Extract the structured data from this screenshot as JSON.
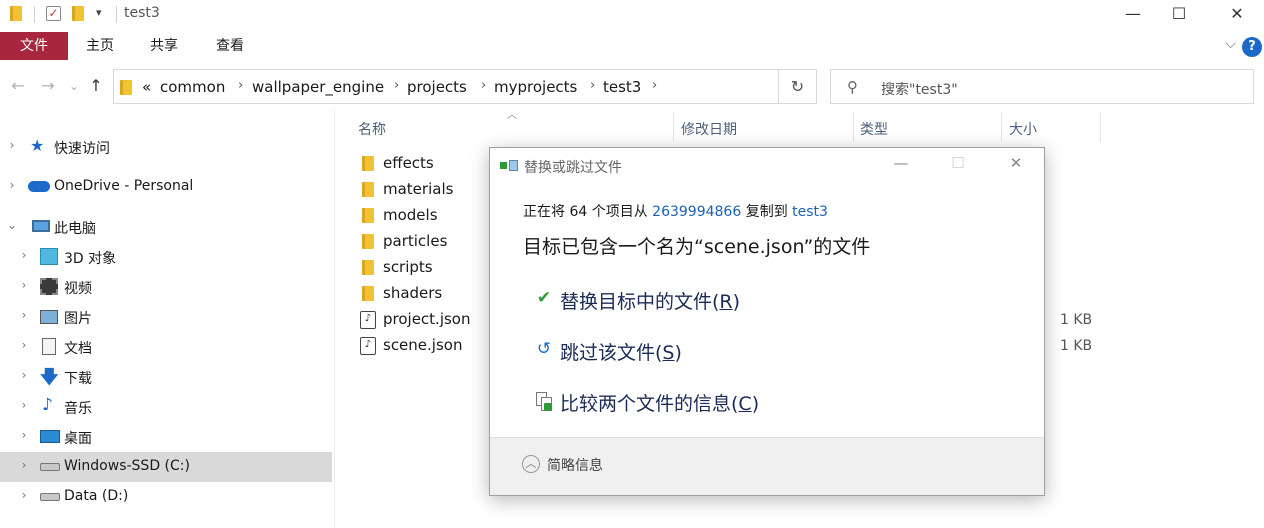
{
  "window": {
    "title": "test3",
    "minimize": "—",
    "maximize": "☐",
    "close": "✕"
  },
  "ribbon": {
    "tabs": [
      "文件",
      "主页",
      "共享",
      "查看"
    ],
    "help": "?",
    "expand": "⌵"
  },
  "nav": {
    "back": "←",
    "forward": "→",
    "recent": "⌄",
    "up": "↑",
    "breadcrumb_overflow": "«",
    "breadcrumbs": [
      "common",
      "wallpaper_engine",
      "projects",
      "myprojects",
      "test3"
    ],
    "refresh": "↻",
    "search_placeholder": "搜索\"test3\""
  },
  "sidebar": {
    "items": [
      {
        "label": "快速访问",
        "icon": "star-icon",
        "expanded": false
      },
      {
        "label": "OneDrive - Personal",
        "icon": "cloud-icon",
        "expanded": false
      },
      {
        "label": "此电脑",
        "icon": "computer-icon",
        "expanded": true
      },
      {
        "label": "3D 对象",
        "icon": "cube-icon",
        "expanded": false
      },
      {
        "label": "视频",
        "icon": "video-icon",
        "expanded": false
      },
      {
        "label": "图片",
        "icon": "picture-icon",
        "expanded": false
      },
      {
        "label": "文档",
        "icon": "document-icon",
        "expanded": false
      },
      {
        "label": "下载",
        "icon": "download-icon",
        "expanded": false
      },
      {
        "label": "音乐",
        "icon": "music-icon",
        "expanded": false
      },
      {
        "label": "桌面",
        "icon": "desktop-icon",
        "expanded": false
      },
      {
        "label": "Windows-SSD (C:)",
        "icon": "drive-icon",
        "expanded": false,
        "selected": true
      },
      {
        "label": "Data (D:)",
        "icon": "drive-icon",
        "expanded": false
      }
    ]
  },
  "filelist": {
    "columns": [
      "名称",
      "修改日期",
      "类型",
      "大小"
    ],
    "files": [
      {
        "name": "effects",
        "kind": "folder",
        "size": ""
      },
      {
        "name": "materials",
        "kind": "folder",
        "size": ""
      },
      {
        "name": "models",
        "kind": "folder",
        "size": ""
      },
      {
        "name": "particles",
        "kind": "folder",
        "size": ""
      },
      {
        "name": "scripts",
        "kind": "folder",
        "size": ""
      },
      {
        "name": "shaders",
        "kind": "folder",
        "size": ""
      },
      {
        "name": "project.json",
        "kind": "json",
        "size": "1 KB"
      },
      {
        "name": "scene.json",
        "kind": "json",
        "size": "1 KB"
      }
    ]
  },
  "dialog": {
    "title": "替换或跳过文件",
    "line_prefix": "正在将 64 个项目从 ",
    "source": "2639994866",
    "line_middle": " 复制到 ",
    "destination": "test3",
    "heading": "目标已包含一个名为“scene.json”的文件",
    "options": [
      {
        "text": "替换目标中的文件(",
        "key": "R",
        "suffix": ")",
        "icon": "checkmark-icon"
      },
      {
        "text": "跳过该文件(",
        "key": "S",
        "suffix": ")",
        "icon": "skip-arrow-icon"
      },
      {
        "text": "比较两个文件的信息(",
        "key": "C",
        "suffix": ")",
        "icon": "compare-files-icon"
      }
    ],
    "footer": "简略信息",
    "colors": {
      "link": "#1a62b8",
      "check": "#2e9a3a",
      "skip": "#1b6ac9"
    }
  },
  "colors": {
    "file_tab": "#a8273f",
    "folder": "#f1c232",
    "selection": "#d9d9d9"
  }
}
